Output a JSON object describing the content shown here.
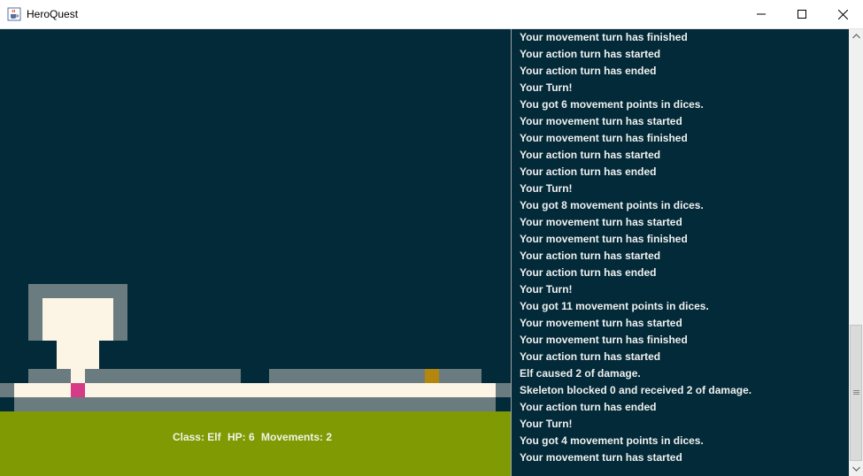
{
  "window": {
    "title": "HeroQuest",
    "icon": "java-cup-icon"
  },
  "controls": {
    "minimize": "minimize-icon",
    "maximize": "maximize-icon",
    "close": "close-icon"
  },
  "colors": {
    "background": "#022a38",
    "wall": "#6b7c81",
    "floor": "#fcf4e4",
    "hero": "#d63b86",
    "item": "#b3870d",
    "status_bar": "#7f9a03"
  },
  "status": {
    "class": "Class: Elf",
    "hp": "HP: 6",
    "movements": "Movements: 2"
  },
  "log": [
    "Your movement turn has finished",
    "Your action turn has started",
    "Your action turn has ended",
    "Your Turn!",
    "You got 6 movement points in dices.",
    "Your movement turn has started",
    "Your movement turn has finished",
    "Your action turn has started",
    "Your action turn has ended",
    "Your Turn!",
    "You got 8 movement points in dices.",
    "Your movement turn has started",
    "Your movement turn has finished",
    "Your action turn has started",
    "Your action turn has ended",
    "Your Turn!",
    "You got 11 movement points in dices.",
    "Your movement turn has started",
    "Your movement turn has finished",
    "Your action turn has started",
    "Elf caused 2 of damage.",
    " Skeleton blocked 0 and received 2 of damage.",
    "Your action turn has ended",
    "Your Turn!",
    "You got 4 movement points in dices.",
    "Your movement turn has started"
  ]
}
